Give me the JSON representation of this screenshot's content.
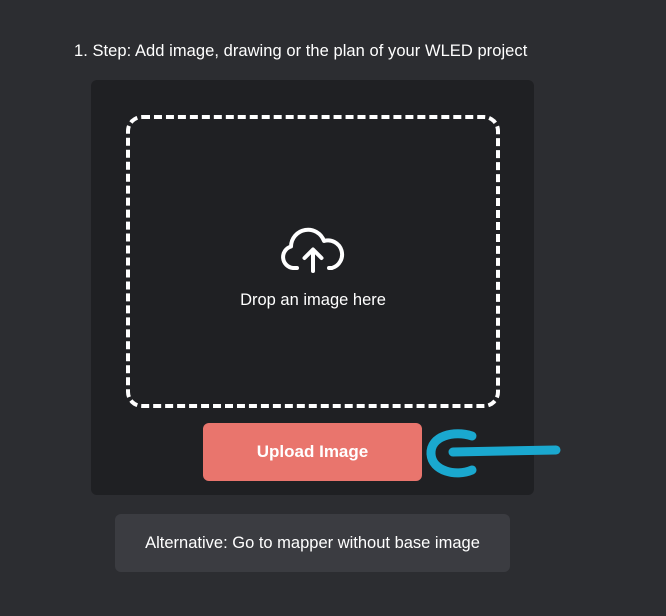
{
  "step": {
    "title": "1. Step: Add image, drawing or the plan of your WLED project"
  },
  "dropzone": {
    "icon": "cloud-upload-icon",
    "text": "Drop an image here"
  },
  "upload": {
    "label": "Upload Image"
  },
  "annotation": {
    "icon": "arrow-pointer-icon",
    "color": "#1aa8cf"
  },
  "alternative": {
    "label": "Alternative: Go to mapper without base image"
  },
  "colors": {
    "background": "#2c2d31",
    "card": "#1f2023",
    "accent": "#e9756d",
    "secondary_button": "#3b3c41",
    "text": "#ffffff"
  }
}
